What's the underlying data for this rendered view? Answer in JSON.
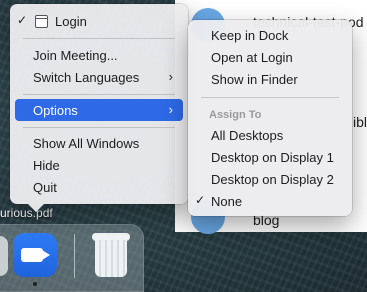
{
  "background": {
    "window_rows": [
      {
        "text": "technical-test-pod"
      },
      {
        "text": "ibli"
      },
      {
        "text": "blog"
      }
    ],
    "desktop_file_label": "urious.pdf"
  },
  "main_menu": {
    "items": [
      {
        "label": "Login",
        "checked": true,
        "icon": "window-icon"
      },
      {
        "label": "Join Meeting..."
      },
      {
        "label": "Switch Languages",
        "submenu": true
      },
      {
        "label": "Options",
        "submenu": true,
        "highlighted": true
      },
      {
        "label": "Show All Windows"
      },
      {
        "label": "Hide"
      },
      {
        "label": "Quit"
      }
    ],
    "chevron": "›",
    "check": "✓"
  },
  "options_submenu": {
    "items": [
      {
        "label": "Keep in Dock"
      },
      {
        "label": "Open at Login"
      },
      {
        "label": "Show in Finder"
      }
    ],
    "assign_header": "Assign To",
    "assign_items": [
      {
        "label": "All Desktops"
      },
      {
        "label": "Desktop on Display 1"
      },
      {
        "label": "Desktop on Display 2"
      },
      {
        "label": "None",
        "checked": true
      }
    ]
  },
  "dock": {
    "apps": [
      {
        "name": "zoom-app-icon",
        "running": true
      },
      {
        "name": "trash-icon",
        "running": false
      }
    ]
  },
  "colors": {
    "highlight": "#2e6ae6",
    "menu_bg": "#ececee"
  }
}
